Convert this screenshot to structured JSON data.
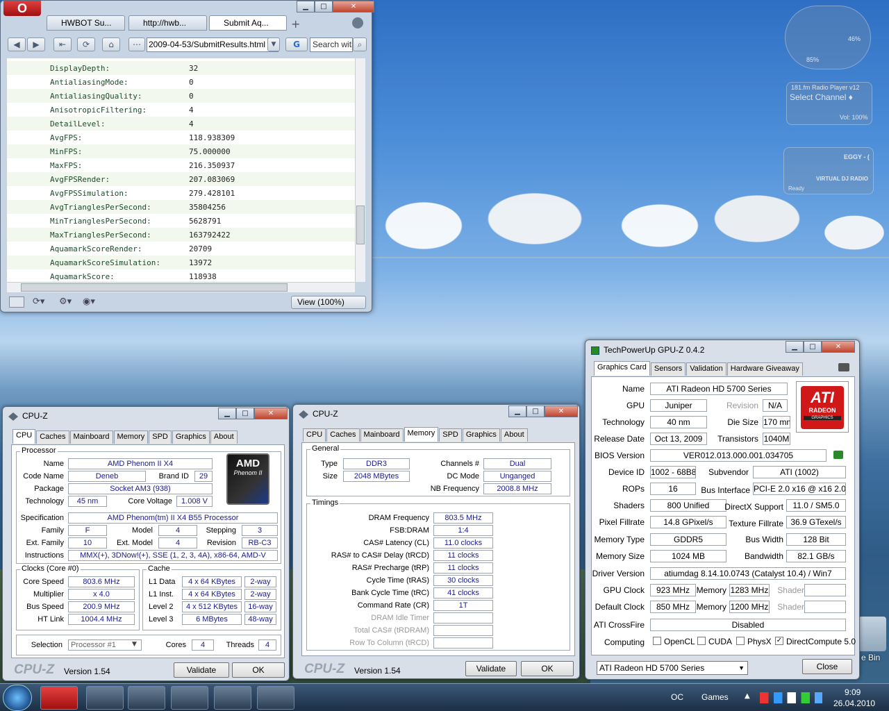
{
  "browser": {
    "tabs": [
      "HWBOT Su...",
      "http://hwb...",
      "Submit Aq..."
    ],
    "address": "2009-04-53/SubmitResults.html",
    "search_placeholder": "Search with",
    "zoom": "View (100%)",
    "rows": [
      {
        "k": "DisplayDepth:",
        "v": "32"
      },
      {
        "k": "AntialiasingMode:",
        "v": "0"
      },
      {
        "k": "AntialiasingQuality:",
        "v": "0"
      },
      {
        "k": "AnisotropicFiltering:",
        "v": "4"
      },
      {
        "k": "DetailLevel:",
        "v": "4"
      },
      {
        "k": "AvgFPS:",
        "v": "118.938309"
      },
      {
        "k": "MinFPS:",
        "v": "75.000000"
      },
      {
        "k": "MaxFPS:",
        "v": "216.350937"
      },
      {
        "k": "AvgFPSRender:",
        "v": "207.083069"
      },
      {
        "k": "AvgFPSSimulation:",
        "v": "279.428101"
      },
      {
        "k": "AvgTrianglesPerSecond:",
        "v": "35804256"
      },
      {
        "k": "MinTrianglesPerSecond:",
        "v": "5628791"
      },
      {
        "k": "MaxTrianglesPerSecond:",
        "v": "163792422"
      },
      {
        "k": "AquamarkScoreRender:",
        "v": "20709"
      },
      {
        "k": "AquamarkScoreSimulation:",
        "v": "13972"
      },
      {
        "k": "AquamarkScore:",
        "v": "118938"
      }
    ]
  },
  "cpuz1": {
    "title": "CPU-Z",
    "tabs": [
      "CPU",
      "Caches",
      "Mainboard",
      "Memory",
      "SPD",
      "Graphics",
      "About"
    ],
    "processor_group": "Processor",
    "name_lbl": "Name",
    "name": "AMD Phenom II X4",
    "codename_lbl": "Code Name",
    "codename": "Deneb",
    "brandid_lbl": "Brand ID",
    "brandid": "29",
    "package_lbl": "Package",
    "package": "Socket AM3 (938)",
    "tech_lbl": "Technology",
    "tech": "45 nm",
    "cv_lbl": "Core Voltage",
    "cv": "1.008 V",
    "spec_lbl": "Specification",
    "spec": "AMD Phenom(tm) II X4 B55 Processor",
    "family_lbl": "Family",
    "family": "F",
    "model_lbl": "Model",
    "model": "4",
    "stepping_lbl": "Stepping",
    "stepping": "3",
    "extfam_lbl": "Ext. Family",
    "extfam": "10",
    "extmodel_lbl": "Ext. Model",
    "extmodel": "4",
    "rev_lbl": "Revision",
    "rev": "RB-C3",
    "instr_lbl": "Instructions",
    "instr": "MMX(+), 3DNow!(+), SSE (1, 2, 3, 4A), x86-64, AMD-V",
    "clocks_group": "Clocks (Core #0)",
    "cs_lbl": "Core Speed",
    "cs": "803.6 MHz",
    "mult_lbl": "Multiplier",
    "mult": "x 4.0",
    "bus_lbl": "Bus Speed",
    "bus": "200.9 MHz",
    "ht_lbl": "HT Link",
    "ht": "1004.4 MHz",
    "cache_group": "Cache",
    "l1d_lbl": "L1 Data",
    "l1d": "4 x 64 KBytes",
    "l1d_w": "2-way",
    "l1i_lbl": "L1 Inst.",
    "l1i": "4 x 64 KBytes",
    "l1i_w": "2-way",
    "l2_lbl": "Level 2",
    "l2": "4 x 512 KBytes",
    "l2_w": "16-way",
    "l3_lbl": "Level 3",
    "l3": "6 MBytes",
    "l3_w": "48-way",
    "sel_lbl": "Selection",
    "sel": "Processor #1",
    "cores_lbl": "Cores",
    "cores": "4",
    "threads_lbl": "Threads",
    "threads": "4",
    "logo_text": "AMD",
    "logo_sub": "Phenom II",
    "brand": "CPU-Z",
    "version": "Version 1.54",
    "validate": "Validate",
    "ok": "OK"
  },
  "cpuz2": {
    "title": "CPU-Z",
    "tabs": [
      "CPU",
      "Caches",
      "Mainboard",
      "Memory",
      "SPD",
      "Graphics",
      "About"
    ],
    "general_group": "General",
    "type_lbl": "Type",
    "type": "DDR3",
    "channels_lbl": "Channels #",
    "channels": "Dual",
    "size_lbl": "Size",
    "size": "2048 MBytes",
    "dc_lbl": "DC Mode",
    "dc": "Unganged",
    "nb_lbl": "NB Frequency",
    "nb": "2008.8 MHz",
    "timings_group": "Timings",
    "t": [
      {
        "l": "DRAM Frequency",
        "v": "803.5 MHz",
        "d": false
      },
      {
        "l": "FSB:DRAM",
        "v": "1:4",
        "d": false
      },
      {
        "l": "CAS# Latency (CL)",
        "v": "11.0 clocks",
        "d": false
      },
      {
        "l": "RAS# to CAS# Delay (tRCD)",
        "v": "11 clocks",
        "d": false
      },
      {
        "l": "RAS# Precharge (tRP)",
        "v": "11 clocks",
        "d": false
      },
      {
        "l": "Cycle Time (tRAS)",
        "v": "30 clocks",
        "d": false
      },
      {
        "l": "Bank Cycle Time (tRC)",
        "v": "41 clocks",
        "d": false
      },
      {
        "l": "Command Rate (CR)",
        "v": "1T",
        "d": false
      },
      {
        "l": "DRAM Idle Timer",
        "v": "",
        "d": true
      },
      {
        "l": "Total CAS# (tRDRAM)",
        "v": "",
        "d": true
      },
      {
        "l": "Row To Column (tRCD)",
        "v": "",
        "d": true
      }
    ],
    "brand": "CPU-Z",
    "version": "Version 1.54",
    "validate": "Validate",
    "ok": "OK"
  },
  "gpuz": {
    "title": "TechPowerUp GPU-Z 0.4.2",
    "tabs": [
      "Graphics Card",
      "Sensors",
      "Validation",
      "Hardware Giveaway"
    ],
    "name_lbl": "Name",
    "name": "ATI Radeon HD 5700 Series",
    "gpu_lbl": "GPU",
    "gpu": "Juniper",
    "rev_lbl": "Revision",
    "rev": "N/A",
    "tech_lbl": "Technology",
    "tech": "40 nm",
    "die_lbl": "Die Size",
    "die": "170 mm²",
    "rel_lbl": "Release Date",
    "rel": "Oct 13, 2009",
    "tr_lbl": "Transistors",
    "tr": "1040M",
    "bios_lbl": "BIOS Version",
    "bios": "VER012.013.000.001.034705",
    "dev_lbl": "Device ID",
    "dev": "1002 - 68B8",
    "sub_lbl": "Subvendor",
    "sub": "ATI (1002)",
    "rops_lbl": "ROPs",
    "rops": "16",
    "bi_lbl": "Bus Interface",
    "bi": "PCI-E 2.0 x16 @ x16 2.0",
    "sh_lbl": "Shaders",
    "sh": "800 Unified",
    "dx_lbl": "DirectX Support",
    "dx": "11.0 / SM5.0",
    "pf_lbl": "Pixel Fillrate",
    "pf": "14.8 GPixel/s",
    "tf_lbl": "Texture Fillrate",
    "tf": "36.9 GTexel/s",
    "mt_lbl": "Memory Type",
    "mt": "GDDR5",
    "bw_lbl": "Bus Width",
    "bw": "128 Bit",
    "ms_lbl": "Memory Size",
    "ms": "1024 MB",
    "band_lbl": "Bandwidth",
    "band": "82.1 GB/s",
    "dv_lbl": "Driver Version",
    "dv": "atiumdag 8.14.10.0743 (Catalyst 10.4) / Win7",
    "gc_lbl": "GPU Clock",
    "gc": "923 MHz",
    "mem_lbl": "Memory",
    "gm": "1283 MHz",
    "shader_lbl": "Shader",
    "dc_lbl": "Default Clock",
    "dcv": "850 MHz",
    "dm": "1200 MHz",
    "cf_lbl": "ATI CrossFire",
    "cf": "Disabled",
    "comp_lbl": "Computing",
    "opencl": "OpenCL",
    "cuda": "CUDA",
    "physx": "PhysX",
    "dcomp": "DirectCompute 5.0",
    "select": "ATI Radeon HD 5700 Series",
    "close": "Close",
    "logo": "ATI",
    "logo_sub": "RADEON",
    "logo_sub2": "GRAPHICS"
  },
  "desktop": {
    "gadget_cpu": "85%",
    "gadget_mem": "46%",
    "radio_title": "181.fm Radio Player v12",
    "radio_select": "Select Channel ♦",
    "radio_vol": "Vol: 100%",
    "vdj": "VIRTUAL DJ RADIO",
    "vdj_name": "EGGY - (",
    "vdj_ready": "Ready",
    "recycle": "e Bin"
  },
  "taskbar": {
    "oc": "OC",
    "games": "Games",
    "time": "9:09",
    "date": "26.04.2010"
  }
}
